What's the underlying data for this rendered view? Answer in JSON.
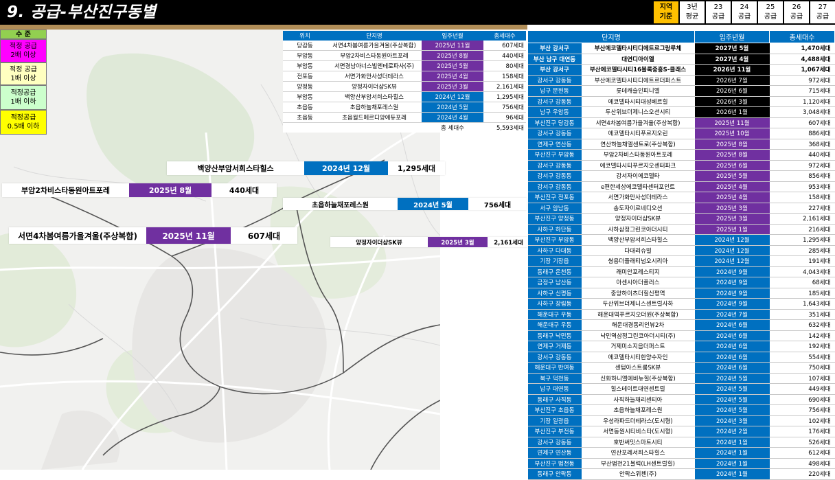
{
  "title": "9. 공급-부산진구동별",
  "period_tabs": [
    {
      "l1": "지역",
      "l2": "기준",
      "active": true
    },
    {
      "l1": "3년",
      "l2": "평균",
      "active": false
    },
    {
      "l1": "23",
      "l2": "공급",
      "active": false
    },
    {
      "l1": "24",
      "l2": "공급",
      "active": false
    },
    {
      "l1": "25",
      "l2": "공급",
      "active": false
    },
    {
      "l1": "26",
      "l2": "공급",
      "active": false
    },
    {
      "l1": "27",
      "l2": "공급",
      "active": false
    }
  ],
  "legend": {
    "header": "수 준",
    "items": [
      {
        "l1": "적정 공급",
        "l2": "2배 이상"
      },
      {
        "l1": "적정 공급",
        "l2": "1배 이상"
      },
      {
        "l1": "적정공급",
        "l2": "1배 이하"
      },
      {
        "l1": "적정공급",
        "l2": "0.5배 이하"
      }
    ]
  },
  "colors": {
    "purple": "#7030a0",
    "blue": "#0070c0",
    "black": "#000000",
    "accent": "#ffc000"
  },
  "mid_table": {
    "headers": [
      "위치",
      "단지명",
      "입주년월",
      "총세대수"
    ],
    "rows": [
      [
        "당감동",
        "서면4차봄여름가을겨울(주상복합)",
        "2025년 11월",
        "607세대"
      ],
      [
        "부암동",
        "부암2차비스타동원아트포레",
        "2025년 8월",
        "440세대"
      ],
      [
        "부암동",
        "서면경남아너스빌엔테로파사(주)",
        "2025년 5월",
        "80세대"
      ],
      [
        "전포동",
        "서면가화만사성더테라스",
        "2025년 4월",
        "158세대"
      ],
      [
        "양정동",
        "양정자이더샵SK뷰",
        "2025년 3월",
        "2,161세대"
      ],
      [
        "부암동",
        "백양산부암서희스타힐스",
        "2024년 12월",
        "1,295세대"
      ],
      [
        "초읍동",
        "초읍하늘채포레스원",
        "2024년 5월",
        "756세대"
      ],
      [
        "초읍동",
        "초읍월드메르디앙에듀포레",
        "2024년 4월",
        "96세대"
      ]
    ],
    "total_label": "총 세대수",
    "total_value": "5,593세대"
  },
  "callouts": [
    {
      "name": "백양산부암서희스타힐스",
      "date": "2024년 12월",
      "count": "1,295세대"
    },
    {
      "name": "부암2차비스타동원아트포레",
      "date": "2025년 8월",
      "count": "440세대"
    },
    {
      "name": "초읍하늘채포레스원",
      "date": "2024년 5월",
      "count": "756세대"
    },
    {
      "name": "서면4차봄여름가을겨울(주상복합)",
      "date": "2025년 11월",
      "count": "607세대"
    },
    {
      "name": "양정자이더샵SK뷰",
      "date": "2025년 3월",
      "count": "2,161세대"
    }
  ],
  "right_table": {
    "headers": [
      "단지명",
      "입주년월",
      "총세대수"
    ],
    "rows": [
      [
        "부산 강서구",
        "부산에코델타시티디에트르그랑루체",
        "2027년 5월",
        "1,470세대",
        "k"
      ],
      [
        "부산 남구 대연동",
        "대연디아이엘",
        "2027년 4월",
        "4,488세대",
        "k"
      ],
      [
        "부산 강서구",
        "부산에코델타시티16블록중흥S-클래스",
        "2026년 11월",
        "1,067세대",
        "k"
      ],
      [
        "강서구 강동동",
        "부산에코델타시티디에트르더퍼스트",
        "2026년 7월",
        "972세대",
        "k"
      ],
      [
        "남구 문현동",
        "롯데캐슬인피니엘",
        "2026년 6월",
        "715세대",
        "k"
      ],
      [
        "강서구 강동동",
        "에코델타시티대성베르힐",
        "2026년 3월",
        "1,120세대",
        "k"
      ],
      [
        "남구 우암동",
        "두산위브더제니스오션시티",
        "2026년 1월",
        "3,048세대",
        "k"
      ],
      [
        "부산진구 당감동",
        "서면4차봄여름가을겨울(주상복합)",
        "2025년 11월",
        "607세대",
        "p"
      ],
      [
        "강서구 강동동",
        "에코델타시티푸르지오린",
        "2025년 10월",
        "886세대",
        "p"
      ],
      [
        "연제구 연산동",
        "연산하늘채엘센트로(주상복합)",
        "2025년 8월",
        "368세대",
        "p"
      ],
      [
        "부산진구 부암동",
        "부암2차비스타동원아트포레",
        "2025년 8월",
        "440세대",
        "p"
      ],
      [
        "강서구 강동동",
        "에코델타시티푸르지오센터파크",
        "2025년 6월",
        "972세대",
        "p"
      ],
      [
        "강서구 강동동",
        "강서자이에코델타",
        "2025년 5월",
        "856세대",
        "p"
      ],
      [
        "강서구 강동동",
        "e편한세상에코델타센터포인트",
        "2025년 4월",
        "953세대",
        "p"
      ],
      [
        "부산진구 전포동",
        "서면가화만사성더테라스",
        "2025년 4월",
        "158세대",
        "p"
      ],
      [
        "서구 암남동",
        "송도자이르네디오션",
        "2025년 3월",
        "227세대",
        "p"
      ],
      [
        "부산진구 양정동",
        "양정자이더샵SK뷰",
        "2025년 3월",
        "2,161세대",
        "p"
      ],
      [
        "사하구 하단동",
        "사하삼정그린코아더시티",
        "2025년 1월",
        "216세대",
        "p"
      ],
      [
        "부산진구 부암동",
        "백양산부암서희스타힐스",
        "2024년 12월",
        "1,295세대",
        "b"
      ],
      [
        "사하구 다대동",
        "다대리슈빌",
        "2024년 12월",
        "285세대",
        "b"
      ],
      [
        "기장 기장읍",
        "쌍용더플래티넘오시리아",
        "2024년 12월",
        "191세대",
        "b"
      ],
      [
        "동래구 온천동",
        "래미안포레스티지",
        "2024년 9월",
        "4,043세대",
        "b"
      ],
      [
        "금정구 남산동",
        "아센시아더플러스",
        "2024년 9월",
        "68세대",
        "b"
      ],
      [
        "사하구 신평동",
        "중앙하이츠더힐신평역",
        "2024년 9월",
        "185세대",
        "b"
      ],
      [
        "사하구 장림동",
        "두산위브더제니스센트럴사하",
        "2024년 9월",
        "1,643세대",
        "b"
      ],
      [
        "해운대구 우동",
        "해운대역푸르지오더원(주상복합)",
        "2024년 7월",
        "351세대",
        "b"
      ],
      [
        "해운대구 우동",
        "해운대경동리인뷰2차",
        "2024년 6월",
        "632세대",
        "b"
      ],
      [
        "동래구 낙민동",
        "낙민역삼정그린코아더시티(주)",
        "2024년 6월",
        "142세대",
        "b"
      ],
      [
        "연제구 거제동",
        "거제미소지음더퍼스트",
        "2024년 6월",
        "192세대",
        "b"
      ],
      [
        "강서구 강동동",
        "에코델타시티한양수자인",
        "2024년 6월",
        "554세대",
        "b"
      ],
      [
        "해운대구 반여동",
        "센텀아스트룸SK뷰",
        "2024년 6월",
        "750세대",
        "b"
      ],
      [
        "북구 덕천동",
        "신화하니엘에비뉴힐(주상복합)",
        "2024년 5월",
        "107세대",
        "b"
      ],
      [
        "남구 대연동",
        "힐스테이트대연센트럴",
        "2024년 5월",
        "449세대",
        "b"
      ],
      [
        "동래구 사직동",
        "사직하늘채리센티아",
        "2024년 5월",
        "690세대",
        "b"
      ],
      [
        "부산진구 초읍동",
        "초읍하늘채포레스원",
        "2024년 5월",
        "756세대",
        "b"
      ],
      [
        "기장 일광읍",
        "우성라파드더테라스(도시형)",
        "2024년 3월",
        "102세대",
        "b"
      ],
      [
        "부산진구 부전동",
        "서면동원시티비스타(도시형)",
        "2024년 2월",
        "176세대",
        "b"
      ],
      [
        "강서구 강동동",
        "호반써밋스마트시티",
        "2024년 1월",
        "526세대",
        "b"
      ],
      [
        "연제구 연산동",
        "연산포레서희스타힐스",
        "2024년 1월",
        "612세대",
        "b"
      ],
      [
        "부산진구 범천동",
        "부산범천21블럭(LH센트럴힐)",
        "2024년 1월",
        "498세대",
        "b"
      ],
      [
        "동래구 안락동",
        "안락스위첸(주)",
        "2024년 1월",
        "220세대",
        "b"
      ]
    ]
  }
}
